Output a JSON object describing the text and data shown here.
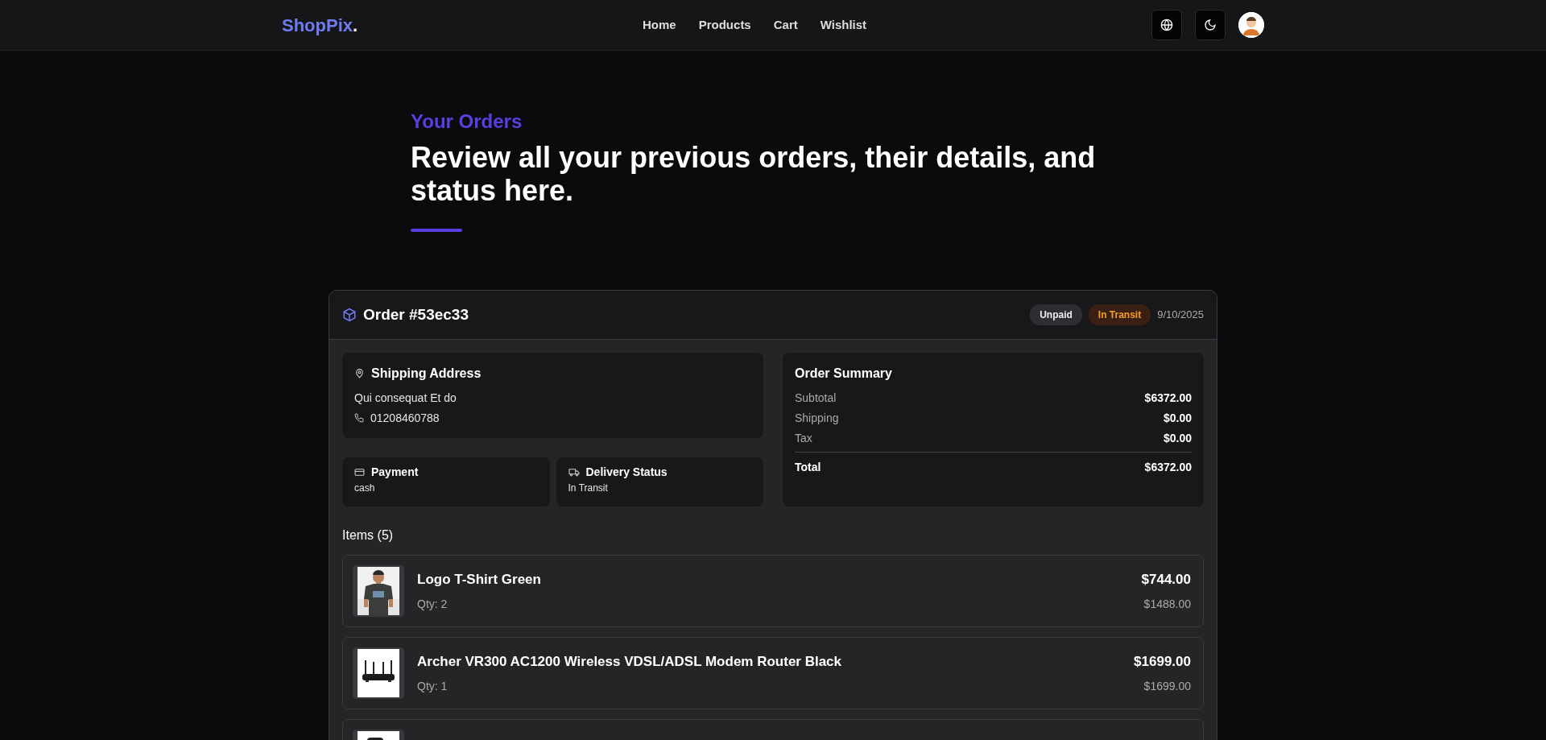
{
  "navbar": {
    "brand": "ShopPix",
    "brand_dot": ".",
    "links": [
      {
        "label": "Home",
        "selected": false
      },
      {
        "label": "Products",
        "selected": false
      },
      {
        "label": "Cart",
        "selected": false
      },
      {
        "label": "Wishlist",
        "selected": false
      }
    ]
  },
  "header": {
    "eyebrow": "Your Orders",
    "title": "Review all your previous orders, their details, and status here."
  },
  "order": {
    "title": "Order #53ec33",
    "badges": [
      {
        "label": "Unpaid",
        "kind": "neutral"
      },
      {
        "label": "In Transit",
        "kind": "warning"
      }
    ],
    "date": "9/10/2025",
    "shipping": {
      "title": "Shipping Address",
      "address": "Qui consequat Et do",
      "phone": "01208460788"
    },
    "payment": {
      "title": "Payment",
      "value": "cash"
    },
    "delivery": {
      "title": "Delivery Status",
      "value": "In Transit"
    },
    "summary": {
      "title": "Order Summary",
      "rows": [
        {
          "label": "Subtotal",
          "value": "$6372.00",
          "kind": "line"
        },
        {
          "label": "Shipping",
          "value": "$0.00",
          "kind": "line"
        },
        {
          "label": "Tax",
          "value": "$0.00",
          "kind": "line"
        },
        {
          "label": "Total",
          "value": "$6372.00",
          "kind": "total"
        }
      ]
    },
    "items_title": "Items (5)",
    "items": [
      {
        "kind": "shirt",
        "name": "Logo T-Shirt Green",
        "qty": "Qty: 2",
        "price": "$744.00",
        "total": "$1488.00"
      },
      {
        "kind": "router",
        "name": "Archer VR300 AC1200 Wireless VDSL/ADSL Modem Router Black",
        "qty": "Qty: 1",
        "price": "$1699.00",
        "total": "$1699.00"
      },
      {
        "kind": "cut"
      }
    ]
  }
}
